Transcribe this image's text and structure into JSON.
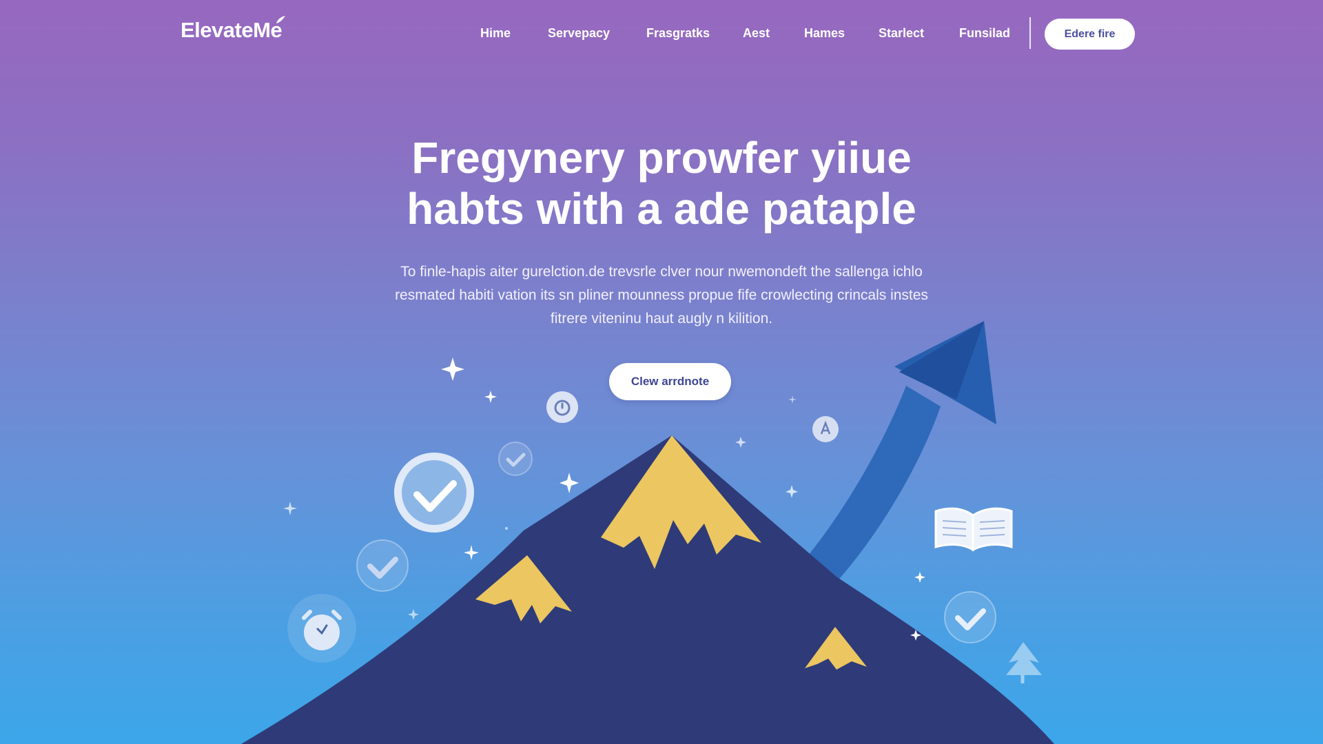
{
  "brand": {
    "name": "ElevateMe"
  },
  "nav": {
    "links": [
      "Hime",
      "Servepacy",
      "Frasgratks",
      "Aest",
      "Hames",
      "Starlect",
      "Funsilad"
    ],
    "cta_label": "Edere fire"
  },
  "hero": {
    "title_lines": [
      "Fregynery prowfer yiiue",
      "habts with a ade pataple"
    ],
    "description_lines": [
      "To finle-hapis aiter gurelction.de trevsrle clver nour nwemondeft the sallenga ichlo",
      "resmated habiti vation its sn pliner mounness propue fife crowlecting crincals instes",
      "fitrere viteninu haut augly n kilition."
    ],
    "cta_label": "Clew arrdnote"
  },
  "illustration": {
    "icons": [
      "star-sparkle-icon",
      "check-circle-icon",
      "alarm-clock-icon",
      "timer-icon",
      "letter-a-badge-icon",
      "open-book-icon",
      "tree-icon",
      "trend-arrow-icon",
      "mountain-icon"
    ],
    "colors": {
      "mountain": "#2e3b78",
      "snow": "#ecc660",
      "arrow": "#2a63b2",
      "accent_text": "#4a4f9e"
    }
  }
}
